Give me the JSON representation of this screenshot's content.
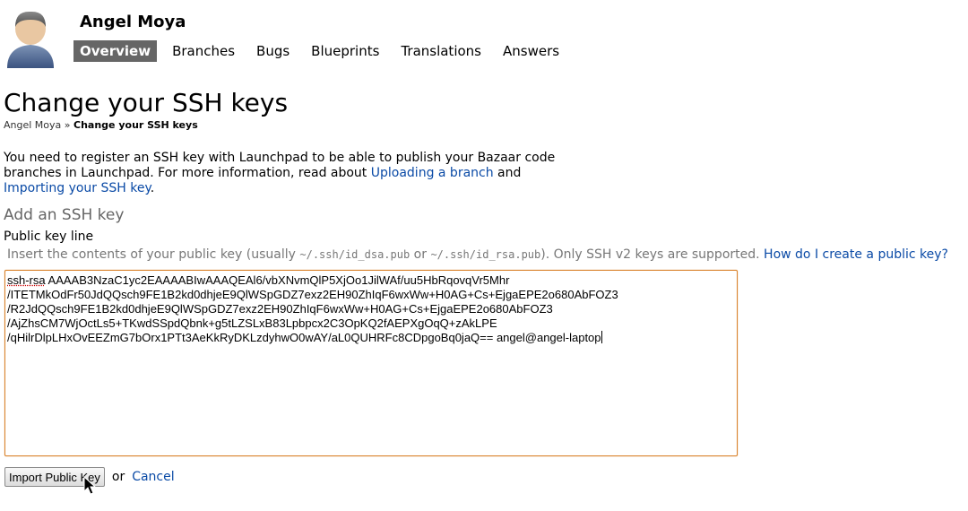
{
  "header": {
    "user_name": "Angel Moya",
    "tabs": [
      {
        "label": "Overview",
        "active": true
      },
      {
        "label": "Branches",
        "active": false
      },
      {
        "label": "Bugs",
        "active": false
      },
      {
        "label": "Blueprints",
        "active": false
      },
      {
        "label": "Translations",
        "active": false
      },
      {
        "label": "Answers",
        "active": false
      }
    ]
  },
  "page": {
    "title": "Change your SSH keys",
    "breadcrumb": {
      "parent": "Angel Moya",
      "separator": "»",
      "current": "Change your SSH keys"
    },
    "intro": {
      "text1": "You need to register an SSH key with Launchpad to be able to publish your Bazaar code branches in Launchpad. For more information, read about ",
      "link1": "Uploading a branch",
      "text2": " and ",
      "link2": "Importing your SSH key",
      "text3": "."
    },
    "section_heading": "Add an SSH key",
    "field_label": "Public key line",
    "hint": {
      "text1": "Insert the contents of your public key (usually ",
      "code1": "~/.ssh/id_dsa.pub",
      "text2": " or ",
      "code2": "~/.ssh/id_rsa.pub",
      "text3": "). Only SSH v2 keys are supported. ",
      "link": "How do I create a public key?"
    },
    "key_lines": [
      "ssh-rsa AAAAB3NzaC1yc2EAAAABIwAAAQEAl6/vbXNvmQlP5XjOo1JilWAf/uu5HbRqovqVr5Mhr",
      "/ITETMkOdFr50JdQQsch9FE1B2kd0dhjeE9QlWSpGDZ7exz2EH90ZhIqF6wxWw+H0AG+Cs+EjgaEPE2o680AbFOZ3",
      "/R2JdQQsch9FE1B2kd0dhjeE9QlWSpGDZ7exz2EH90ZhIqF6wxWw+H0AG+Cs+EjgaEPE2o680AbFOZ3",
      "/AjZhsCM7WjOctLs5+TKwdSSpdQbnk+g5tLZSLxB83Lpbpcx2C3OpKQ2fAEPXgOqQ+zAkLPE",
      "/qHilrDlpLHxOvEEZmG7bOrx1PTt3AeKkRyDKLzdyhwO0wAY/aL0QUHRFc8CDpgoBq0jaQ== angel@angel-laptop"
    ],
    "import_button": "Import Public Key",
    "or_text": "or",
    "cancel_link": "Cancel"
  },
  "icons": {
    "avatar": "person-avatar-icon",
    "cursor": "mouse-pointer-icon"
  },
  "colors": {
    "link": "#0a4aa6",
    "active_tab": "#666666",
    "focus_border": "#d9822b"
  }
}
